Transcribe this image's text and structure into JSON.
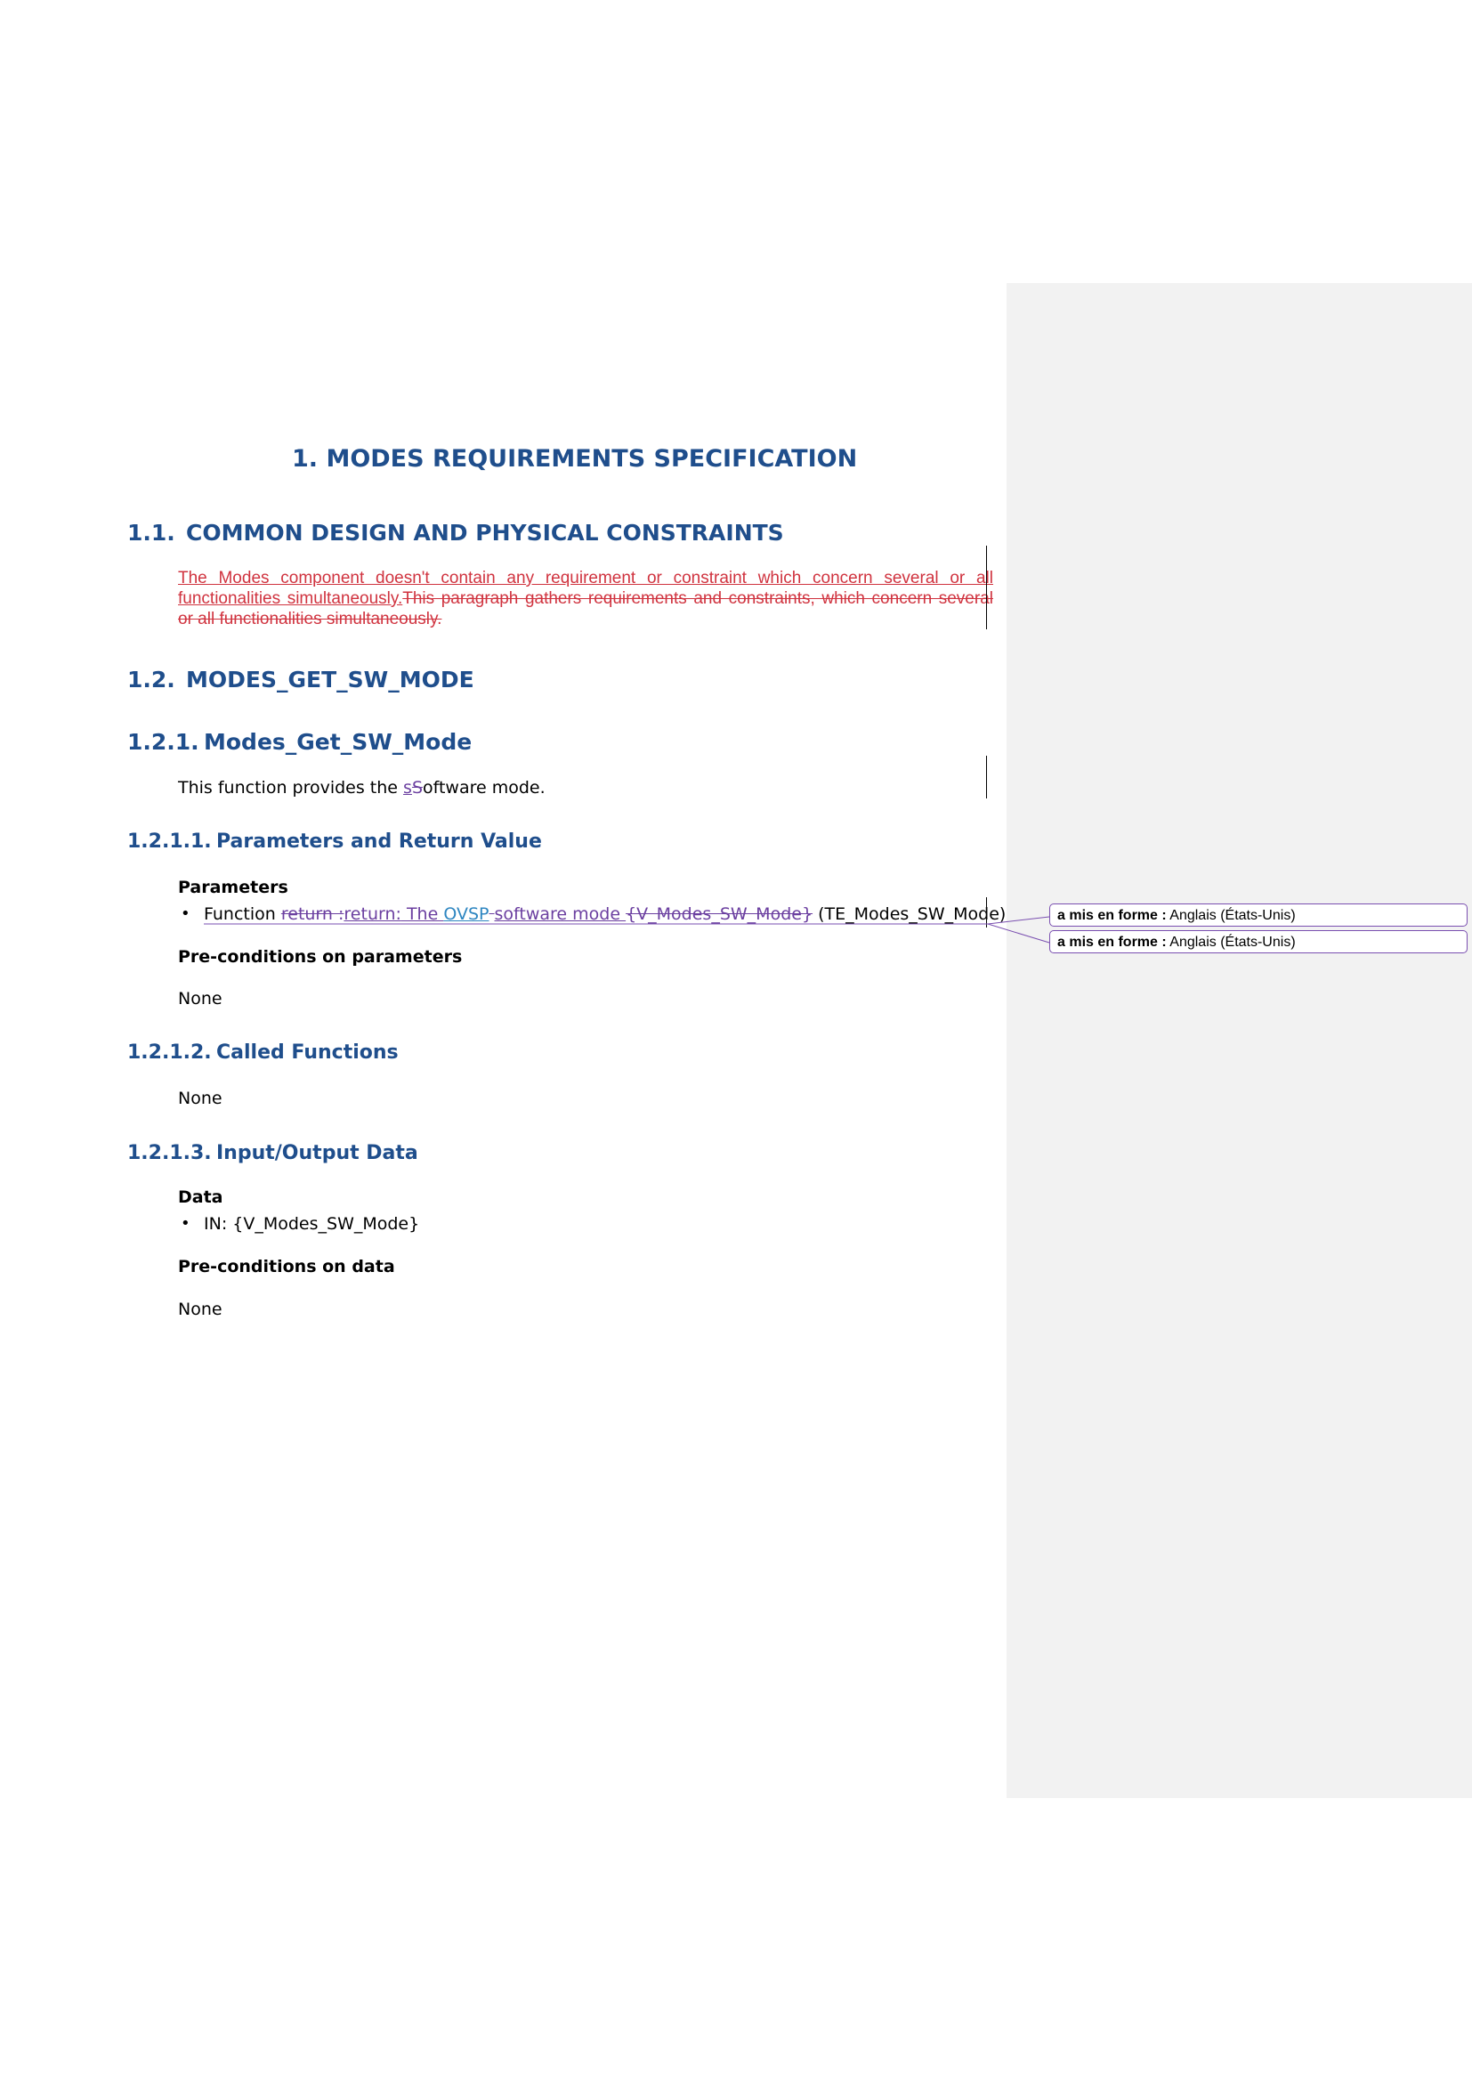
{
  "heading1": {
    "number": "1.",
    "text": "MODES REQUIREMENTS SPECIFICATION"
  },
  "sec_1_1": {
    "number": "1.1.",
    "text": "COMMON DESIGN AND PHYSICAL CONSTRAINTS"
  },
  "tracked_para": {
    "inserted": "The Modes component doesn't contain any requirement or constraint which concern several or all functionalities simultaneously.",
    "deleted": "This paragraph gathers requirements and constraints, which concern several or all functionalities simultaneously."
  },
  "sec_1_2": {
    "number": "1.2.",
    "text": "MODES_GET_SW_MODE"
  },
  "sec_1_2_1": {
    "number": "1.2.1.",
    "text": "Modes_Get_SW_Mode"
  },
  "func_desc": {
    "prefix": "This function provides the ",
    "ins": "s",
    "del": "S",
    "suffix": "oftware mode."
  },
  "sec_1_2_1_1": {
    "number": "1.2.1.1.",
    "text": "Parameters and Return Value"
  },
  "parameters": {
    "label": "Parameters",
    "bullet": "•",
    "item": {
      "func": "Function ",
      "del1": "return :",
      "ins1": "return:",
      "ins2": " The ",
      "ovsp": "OVSP",
      "del2": " ",
      "ins3": "software mode ",
      "del3": "{V_Modes_SW_Mode}",
      "rest": " (TE_Modes_SW_Mode)"
    },
    "pre_label": "Pre-conditions on parameters",
    "pre_value": "None"
  },
  "sec_1_2_1_2": {
    "number": "1.2.1.2.",
    "text": "Called Functions",
    "value": "None"
  },
  "sec_1_2_1_3": {
    "number": "1.2.1.3.",
    "text": "Input/Output Data"
  },
  "data": {
    "label": "Data",
    "bullet": "•",
    "item": "IN: {V_Modes_SW_Mode}",
    "pre_label": "Pre-conditions on data",
    "pre_value": "None"
  },
  "comments": [
    {
      "label": "a mis en forme :",
      "value": " Anglais (États-Unis)"
    },
    {
      "label": "a mis en forme :",
      "value": " Anglais (États-Unis)"
    }
  ],
  "colors": {
    "heading": "#1f4e8c",
    "insert_red": "#d0333f",
    "insert_purple": "#6b3fa0",
    "insert_blue": "#2e86c1",
    "comment_border": "#7a4fb0"
  }
}
